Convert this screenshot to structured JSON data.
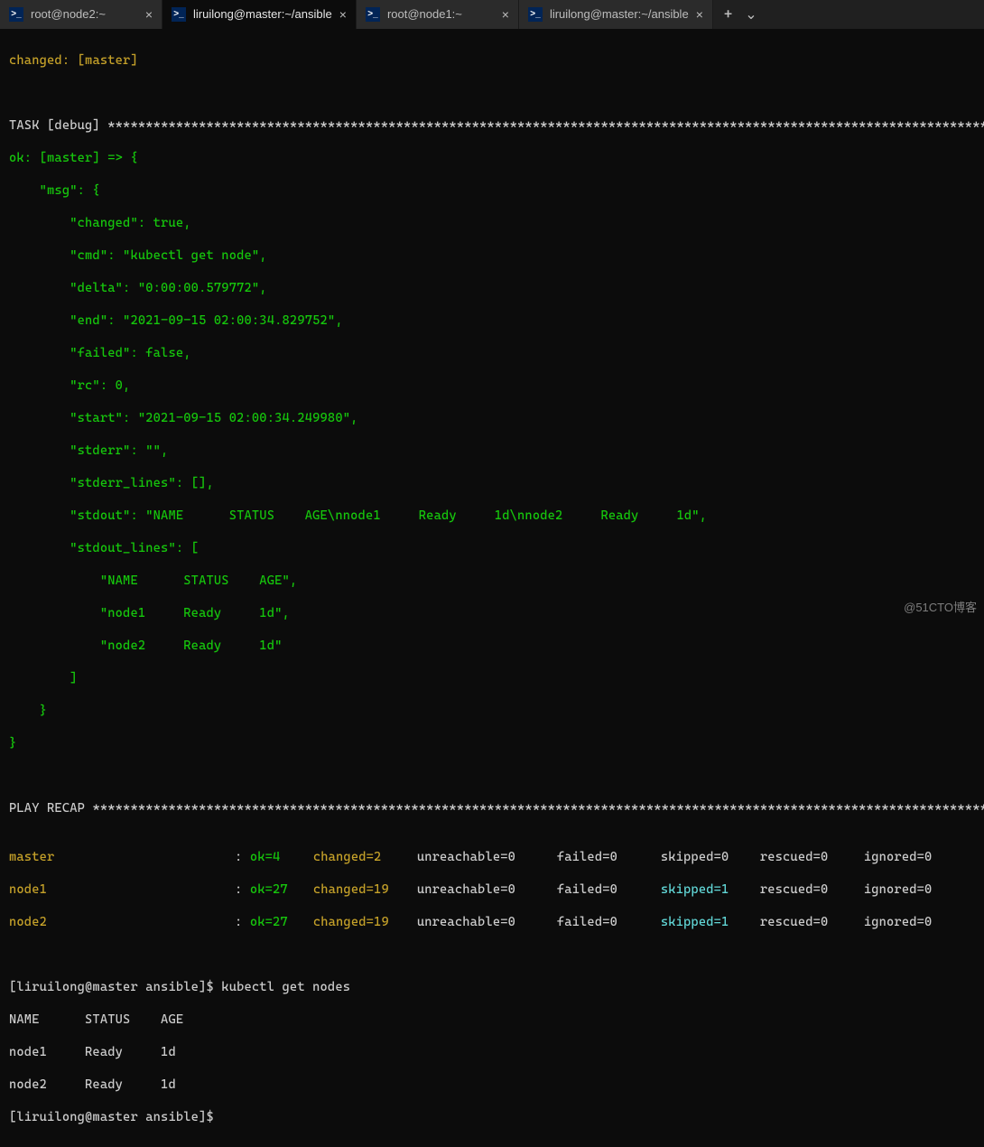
{
  "tabs": [
    {
      "title": "root@node2:~",
      "active": false
    },
    {
      "title": "liruilong@master:~/ansible",
      "active": true
    },
    {
      "title": "root@node1:~",
      "active": false
    },
    {
      "title": "liruilong@master:~/ansible",
      "active": false
    }
  ],
  "tab_controls": {
    "plus": "+",
    "chevron": "⌄"
  },
  "changed_line": {
    "prefix": "changed: ",
    "host": "[master]"
  },
  "task_header": {
    "label": "TASK [debug] ",
    "stars": "**********************************************************************************************************************"
  },
  "ok_header": {
    "ok": "ok: ",
    "host": "[master]",
    "arrow": " => {"
  },
  "msg": {
    "open": "    \"msg\": {",
    "changed": "        \"changed\": true,",
    "cmd": "        \"cmd\": \"kubectl get node\",",
    "delta": "        \"delta\": \"0:00:00.579772\",",
    "end": "        \"end\": \"2021-09-15 02:00:34.829752\",",
    "failed": "        \"failed\": false,",
    "rc": "        \"rc\": 0,",
    "start": "        \"start\": \"2021-09-15 02:00:34.249980\",",
    "stderr": "        \"stderr\": \"\",",
    "stderr_lines": "        \"stderr_lines\": [],",
    "stdout": "        \"stdout\": \"NAME      STATUS    AGE\\nnode1     Ready     1d\\nnode2     Ready     1d\",",
    "stdout_lines_open": "        \"stdout_lines\": [",
    "l1": "            \"NAME      STATUS    AGE\",",
    "l2": "            \"node1     Ready     1d\",",
    "l3": "            \"node2     Ready     1d\"",
    "stdout_lines_close": "        ]",
    "close": "    }",
    "outer_close": "}"
  },
  "recap_header": {
    "label": "PLAY RECAP ",
    "stars": "************************************************************************************************************************"
  },
  "recap": [
    {
      "host": "master",
      "ok": "ok=4",
      "changed": "changed=2",
      "unreachable": "unreachable=0",
      "failed": "failed=0",
      "skipped": "skipped=0",
      "skipped_hi": false,
      "rescued": "rescued=0",
      "ignored": "ignored=0"
    },
    {
      "host": "node1",
      "ok": "ok=27",
      "changed": "changed=19",
      "unreachable": "unreachable=0",
      "failed": "failed=0",
      "skipped": "skipped=1",
      "skipped_hi": true,
      "rescued": "rescued=0",
      "ignored": "ignored=0"
    },
    {
      "host": "node2",
      "ok": "ok=27",
      "changed": "changed=19",
      "unreachable": "unreachable=0",
      "failed": "failed=0",
      "skipped": "skipped=1",
      "skipped_hi": true,
      "rescued": "rescued=0",
      "ignored": "ignored=0"
    }
  ],
  "shell": {
    "prompt1": "[liruilong@master ansible]$ kubectl get nodes",
    "head": "NAME      STATUS    AGE",
    "n1": "node1     Ready     1d",
    "n2": "node2     Ready     1d",
    "prompt2": "[liruilong@master ansible]$ "
  },
  "watermark": "@51CTO博客",
  "icon_glyph": ">_"
}
